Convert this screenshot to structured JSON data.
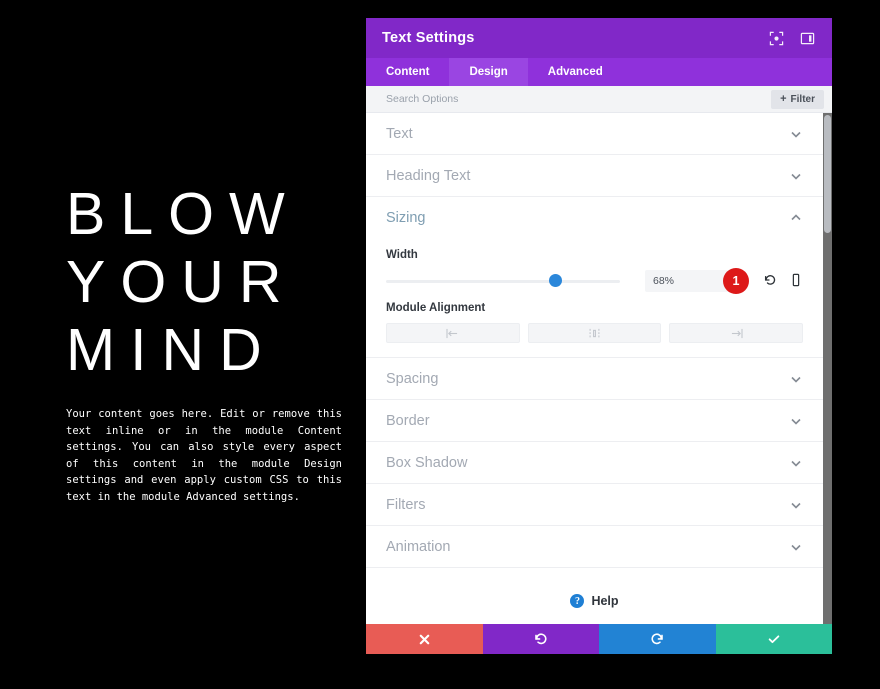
{
  "preview": {
    "heading_lines": [
      "BLOW",
      "YOUR",
      "MIND"
    ],
    "paragraph": "Your content goes here. Edit or remove this text inline or in the module Content settings. You can also style every aspect of this content in the module Design settings and even apply custom CSS to this text in the module Advanced settings.",
    "background_color": "#000000",
    "text_color": "#ffffff"
  },
  "panel": {
    "title": "Text Settings",
    "header_color": "#8128c8",
    "header_icons": [
      {
        "name": "expand-icon",
        "label": "Expand"
      },
      {
        "name": "layout-toggle-icon",
        "label": "Layout"
      }
    ],
    "tabs": [
      {
        "label": "Content",
        "active": false
      },
      {
        "label": "Design",
        "active": true
      },
      {
        "label": "Advanced",
        "active": false
      }
    ],
    "search": {
      "placeholder": "Search Options",
      "value": "",
      "filter_label": "Filter",
      "filter_plus": "+"
    },
    "sections": [
      {
        "label": "Text",
        "open": false
      },
      {
        "label": "Heading Text",
        "open": false
      }
    ],
    "sizing": {
      "label": "Sizing",
      "open": true,
      "width": {
        "label": "Width",
        "value": "68%",
        "slider_percent": 68,
        "badge": "1",
        "reset_icon": "reset-icon",
        "responsive_icon": "mobile-icon"
      },
      "module_alignment": {
        "label": "Module Alignment",
        "options": [
          {
            "name": "align-left-icon",
            "label": "Left"
          },
          {
            "name": "align-center-icon",
            "label": "Center"
          },
          {
            "name": "align-right-icon",
            "label": "Right"
          }
        ]
      }
    },
    "sections_below": [
      {
        "label": "Spacing",
        "open": false
      },
      {
        "label": "Border",
        "open": false
      },
      {
        "label": "Box Shadow",
        "open": false
      },
      {
        "label": "Filters",
        "open": false
      },
      {
        "label": "Animation",
        "open": false
      }
    ],
    "help": {
      "label": "Help",
      "icon_char": "?"
    },
    "footer_buttons": [
      {
        "name": "cancel-button",
        "icon": "close-icon",
        "color": "#e85c55"
      },
      {
        "name": "undo-button",
        "icon": "undo-icon",
        "color": "#8128c8"
      },
      {
        "name": "redo-button",
        "icon": "redo-icon",
        "color": "#2283d4"
      },
      {
        "name": "save-button",
        "icon": "check-icon",
        "color": "#2bbf9a"
      }
    ]
  }
}
